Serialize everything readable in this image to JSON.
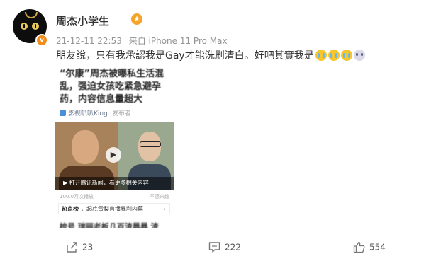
{
  "post": {
    "username": "周杰小学生",
    "timestamp": "21-12-11 22:53",
    "source": "来自 iPhone 11 Pro Max",
    "text": "朋友說，只有我承認我是Gay才能洗刷清白。好吧其實我是",
    "emoji_icons": [
      "crying-emoji",
      "crying-emoji",
      "crying-emoji",
      "dizzy-emoji"
    ]
  },
  "attachment": {
    "headline": "“尔康”周杰被曝私生活混乱，强迫女孩吃紧急避孕药，内容信息量超大",
    "source_name": "影视叭叭King",
    "source_tag": "发布者",
    "video_overlay": "▶ 打开腾讯新闻，看更多相关内容",
    "stat_left": "100.0万次播放",
    "stat_right": "不感兴趣",
    "hot_tag": "热点榜",
    "hot_text": "，起底雪梨直播暴利内幕",
    "hot_chevron": "›",
    "more_text": "梳号    瑞丽老板几百渣暴暴    渣"
  },
  "actions": {
    "repost_count": "23",
    "comment_count": "222",
    "like_count": "554"
  },
  "colors": {
    "meta_gray": "#939393",
    "verified_orange": "#f28c1d",
    "text": "#333333"
  }
}
